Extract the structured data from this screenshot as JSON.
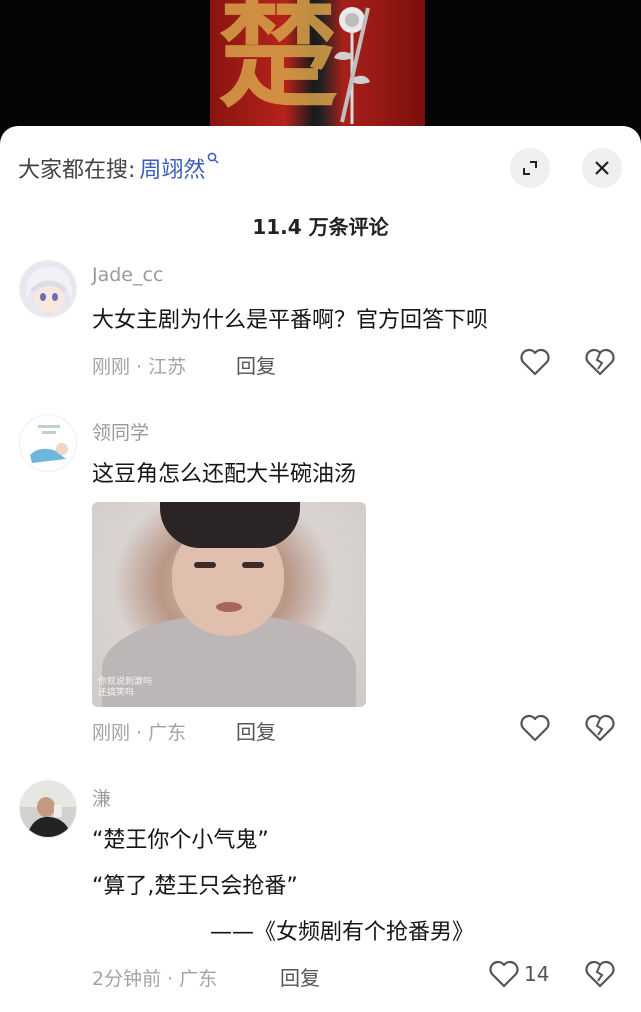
{
  "poster": {
    "glyph": "楚"
  },
  "search": {
    "prefix": "大家都在搜:",
    "term": "周翊然"
  },
  "comment_count": "11.4 万条评论",
  "comments": [
    {
      "user": "Jade_cc",
      "lines": [
        "大女主剧为什么是平番啊？官方回答下呗"
      ],
      "meta": "刚刚 · 江苏",
      "reply": "回复",
      "likes": ""
    },
    {
      "user": "领同学",
      "lines": [
        "这豆角怎么还配大半碗油汤"
      ],
      "image_caption": [
        "你就说刺激吗",
        "还搞笑吗"
      ],
      "meta": "刚刚 · 广东",
      "reply": "回复",
      "likes": ""
    },
    {
      "user": "溓",
      "lines": [
        "“楚王你个小气鬼”",
        "“算了,楚王只会抢番”",
        "——《女频剧有个抢番男》"
      ],
      "meta": "2分钟前 · 广东",
      "reply": "回复",
      "likes": "14"
    }
  ],
  "icons": {
    "expand": "expand-icon",
    "close": "close-icon",
    "like": "heart-icon",
    "dislike": "broken-heart-icon",
    "search": "search-icon"
  }
}
